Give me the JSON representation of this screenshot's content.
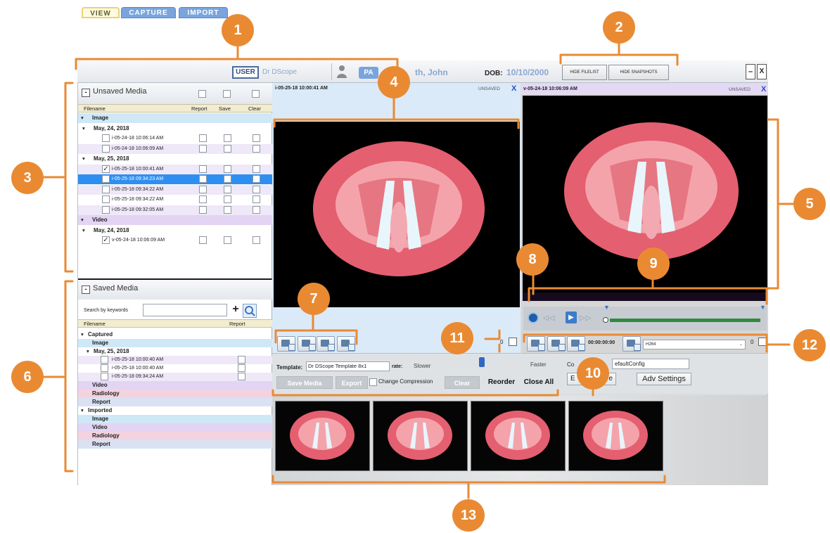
{
  "header": {
    "tabs": [
      {
        "label": "VIEW"
      },
      {
        "label": "CAPTURE"
      },
      {
        "label": "IMPORT"
      }
    ],
    "user_badge": "USER",
    "user_name": "Dr DScope",
    "patient_badge": "PA",
    "patient_name": "th, John",
    "dob_label": "DOB:",
    "dob_value": "10/10/2000",
    "hide_filelist": "HIDE FILELIST",
    "hide_snapshots": "HIDE SNAPSHOTS",
    "minimize": "–",
    "close": "X"
  },
  "unsaved_media": {
    "collapse": "-",
    "title": "Unsaved Media",
    "columns": [
      "Filename",
      "Report",
      "Save",
      "Clear"
    ],
    "rows": [
      {
        "label": "Image",
        "level": 0
      },
      {
        "label": "May, 24, 2018",
        "level": 1
      },
      {
        "label": "i-05-24-18 10:06:14 AM",
        "level": 2,
        "checked": false,
        "boxes": true
      },
      {
        "label": "i-05-24-18 10:06:09 AM",
        "level": 2,
        "checked": false,
        "boxes": true
      },
      {
        "label": "May, 25, 2018",
        "level": 1
      },
      {
        "label": "i-05-25-18 10:00:41 AM",
        "level": 2,
        "checked": true,
        "boxes": true
      },
      {
        "label": "i-05-25-18 09:34:23 AM",
        "level": 2,
        "checked": false,
        "boxes": true,
        "selected": true
      },
      {
        "label": "i-05-25-18 09:34:22 AM",
        "level": 2,
        "checked": false,
        "boxes": true
      },
      {
        "label": "i-05-25-18 09:34:22 AM",
        "level": 2,
        "checked": false,
        "boxes": true
      },
      {
        "label": "i-05-25-18 09:32:05 AM",
        "level": 2,
        "checked": false,
        "boxes": true
      },
      {
        "label": "Video",
        "level": 0
      },
      {
        "label": "May, 24, 2018",
        "level": 1
      },
      {
        "label": "v-05-24-18 10:06:09 AM",
        "level": 2,
        "checked": true,
        "boxes": true
      }
    ]
  },
  "saved_media": {
    "collapse": "-",
    "title": "Saved Media",
    "search_label": "Search by keywords",
    "search_value": "",
    "columns": [
      "Filename",
      "Report"
    ],
    "rows": [
      {
        "label": "Captured",
        "level": 0,
        "plain": true
      },
      {
        "label": "Image",
        "level": 0,
        "band": "#cfe8f7"
      },
      {
        "label": "May, 25, 2018",
        "level": 1
      },
      {
        "label": "i-05-25-18 10:00:40 AM",
        "level": 2,
        "box": true
      },
      {
        "label": "i-05-25-18 10:00:40 AM",
        "level": 2,
        "box": true
      },
      {
        "label": "i-05-25-18 09:34:24 AM",
        "level": 2,
        "box": true
      },
      {
        "label": "Video",
        "level": 0,
        "band": "#e3d4f3"
      },
      {
        "label": "Radiology",
        "level": 0,
        "band": "#f3d3df"
      },
      {
        "label": "Report",
        "level": 0,
        "band": "#d9e2f3"
      },
      {
        "label": "Imported",
        "level": 0,
        "plain": true
      },
      {
        "label": "Image",
        "level": 0,
        "band": "#cfe8f7"
      },
      {
        "label": "Video",
        "level": 0,
        "band": "#e3d4f3"
      },
      {
        "label": "Radiology",
        "level": 0,
        "band": "#f3d3df"
      },
      {
        "label": "Report",
        "level": 0,
        "band": "#d9e2f3"
      }
    ]
  },
  "left_viewer": {
    "title": "i-05-25-18 10:00:41 AM",
    "status": "UNSAVED",
    "close": "X",
    "count": "0"
  },
  "right_viewer": {
    "title": "v-05-24-18 10:06:09 AM",
    "status": "UNSAVED",
    "close": "X",
    "timecode": "00:00:00:00",
    "codec": "H264",
    "count": "0"
  },
  "bottom_controls": {
    "template_label": "Template:",
    "template_value": "Dr DScope Template 8x1",
    "rate_label": "rate:",
    "slower": "Slower",
    "faster": "Faster",
    "save_media": "Save Media",
    "export": "Export",
    "change_compression": "Change Compression",
    "clear": "Clear",
    "reorder": "Reorder",
    "close_all": "Close All",
    "config_left": "Co",
    "config_value": "efaultConfig",
    "edit_partial": "E",
    "e_partial": "e",
    "adv_settings": "Adv Settings"
  },
  "callouts": [
    "1",
    "2",
    "3",
    "4",
    "5",
    "6",
    "7",
    "8",
    "9",
    "10",
    "11",
    "12",
    "13"
  ],
  "colors": {
    "accent_orange": "#e98a33",
    "blue_tab": "#6f9ad8",
    "selected_row": "#2f8ff0",
    "viewer_header": "#d6e9fb",
    "video_header": "#e4d9f5"
  }
}
